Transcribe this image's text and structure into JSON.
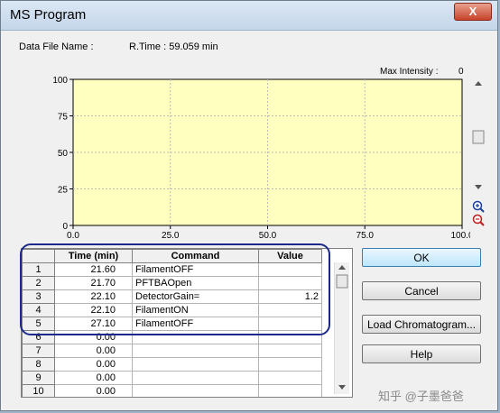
{
  "window": {
    "title": "MS Program",
    "close_label": "X"
  },
  "info": {
    "data_file_label": "Data File Name :",
    "rtime_label": "R.Time : 59.059 min",
    "max_intensity_label": "Max Intensity :",
    "max_intensity_value": "0"
  },
  "chart_data": {
    "type": "line",
    "series": [],
    "xlim": [
      0,
      100
    ],
    "ylim": [
      0,
      100
    ],
    "xticks": [
      "0.0",
      "25.0",
      "50.0",
      "75.0",
      "100.0"
    ],
    "yticks": [
      "0",
      "25",
      "50",
      "75",
      "100"
    ],
    "grid": true,
    "background": "#ffffc0"
  },
  "table": {
    "headers": [
      "",
      "Time (min)",
      "Command",
      "Value"
    ],
    "rows": [
      {
        "n": "1",
        "time": "21.60",
        "command": "FilamentOFF",
        "value": ""
      },
      {
        "n": "2",
        "time": "21.70",
        "command": "PFTBAOpen",
        "value": ""
      },
      {
        "n": "3",
        "time": "22.10",
        "command": "DetectorGain=",
        "value": "1.2"
      },
      {
        "n": "4",
        "time": "22.10",
        "command": "FilamentON",
        "value": ""
      },
      {
        "n": "5",
        "time": "27.10",
        "command": "FilamentOFF",
        "value": ""
      },
      {
        "n": "6",
        "time": "0.00",
        "command": "",
        "value": ""
      },
      {
        "n": "7",
        "time": "0.00",
        "command": "",
        "value": ""
      },
      {
        "n": "8",
        "time": "0.00",
        "command": "",
        "value": ""
      },
      {
        "n": "9",
        "time": "0.00",
        "command": "",
        "value": ""
      },
      {
        "n": "10",
        "time": "0.00",
        "command": "",
        "value": ""
      }
    ]
  },
  "buttons": {
    "ok": "OK",
    "cancel": "Cancel",
    "load": "Load Chromatogram...",
    "help": "Help"
  },
  "watermark": "知乎 @子墨爸爸",
  "icons": [
    "close-icon",
    "zoom-in-icon",
    "zoom-out-icon",
    "scroll-up-arrow-icon",
    "scroll-down-arrow-icon"
  ],
  "colors": {
    "chart_bg": "#ffffc0",
    "highlight": "#1b2a8a",
    "ok_border": "#3c7fb1"
  }
}
